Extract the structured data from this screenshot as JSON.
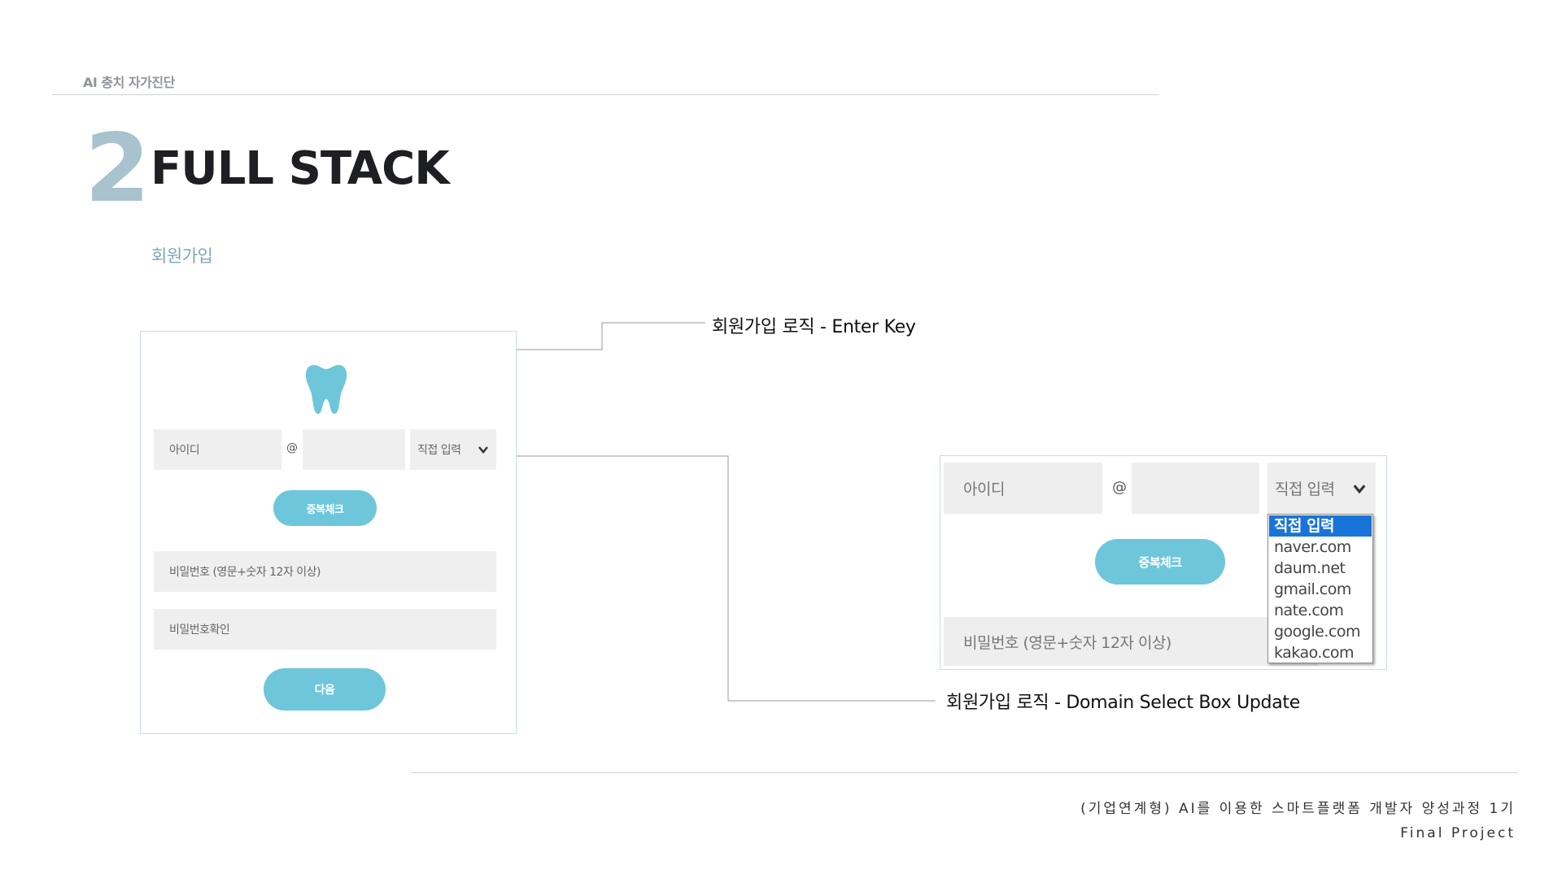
{
  "header": {
    "label": "AI 충치 자가진단",
    "section_number": "2",
    "section_title": "FULL STACK",
    "sub_title": "회원가입"
  },
  "form": {
    "logo_icon": "tooth-icon",
    "id_placeholder": "아이디",
    "at_symbol": "@",
    "domain_select_value": "직접 입력",
    "dup_check_button": "중복체크",
    "password_placeholder": "비밀번호 (영문+숫자 12자 이상)",
    "password_confirm_placeholder": "비밀번호확인",
    "next_button": "다음"
  },
  "annotations": {
    "enter_key": "회원가입 로직 - Enter Key",
    "domain_select": "회원가입 로직 - Domain Select Box Update"
  },
  "zoom": {
    "id_placeholder": "아이디",
    "at_symbol": "@",
    "domain_select_value": "직접 입력",
    "dup_check_button": "중복체크",
    "password_placeholder": "비밀번호 (영문+숫자 12자 이상)",
    "domain_options": [
      "직접 입력",
      "naver.com",
      "daum.net",
      "gmail.com",
      "nate.com",
      "google.com",
      "kakao.com"
    ],
    "selected_index": 0
  },
  "footer": {
    "line1": "(기업연계형) AI를 이용한 스마트플랫폼 개발자 양성과정 1기",
    "line2": "Final Project"
  },
  "colors": {
    "accent": "#6ec6da",
    "section_number": "#a8c2ce",
    "sub_title": "#7ba7ba",
    "select_highlight": "#1874d8"
  }
}
